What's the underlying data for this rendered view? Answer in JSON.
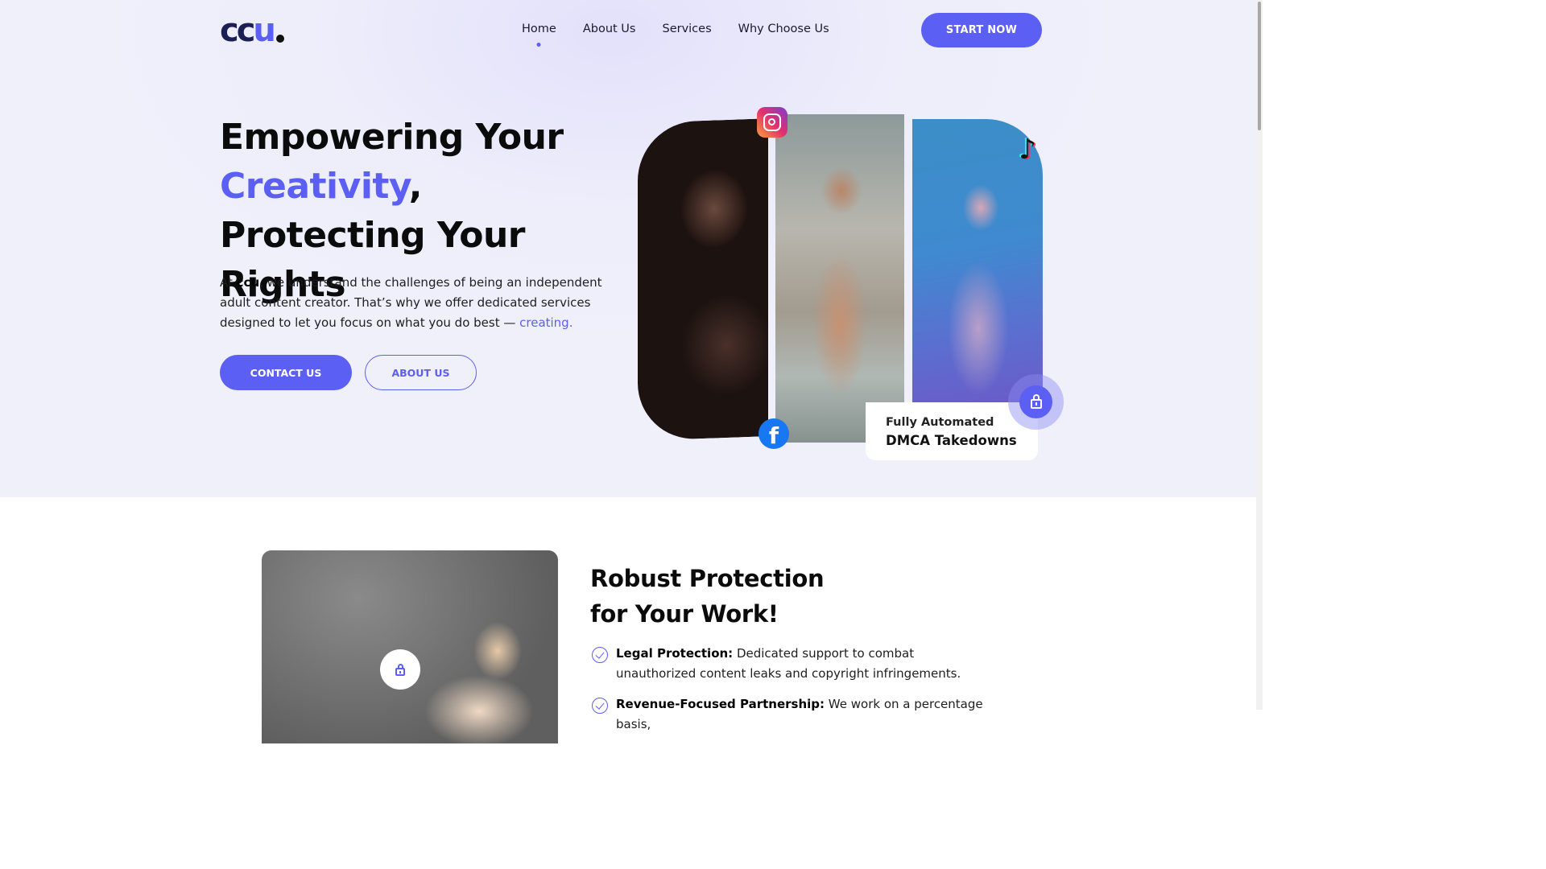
{
  "brand": {
    "logo_text_dark": "cc",
    "logo_text_accent": "u",
    "logo_alt": "ccu."
  },
  "nav": {
    "items": [
      {
        "label": "Home",
        "active": true
      },
      {
        "label": "About Us",
        "active": false
      },
      {
        "label": "Services",
        "active": false
      },
      {
        "label": "Why Choose Us",
        "active": false
      }
    ],
    "cta_label": "START NOW"
  },
  "hero": {
    "title_part1": "Empowering Your",
    "title_accent": "Creativity",
    "title_part2": ", Protecting Your Rights",
    "lead_prefix": "At ",
    "lead_brand": "ccu",
    "lead_body": ", we understand the challenges of being an independent adult content creator. That’s why we offer dedicated services designed to let you focus on what you do best — ",
    "lead_link": "creating.",
    "contact_label": "CONTACT US",
    "about_label": "ABOUT US",
    "badge_line1": "Fully Automated",
    "badge_line2": "DMCA Takedowns",
    "social_icons": [
      "instagram-icon",
      "tiktok-icon",
      "facebook-icon"
    ]
  },
  "protection": {
    "title_line1": "Robust Protection",
    "title_line2": "for Your Work!",
    "features": [
      {
        "title": "Legal Protection:",
        "text": " Dedicated support to combat unauthorized content leaks and copyright infringements."
      },
      {
        "title": "Revenue-Focused Partnership:",
        "text": " We work on a percentage basis,"
      }
    ]
  },
  "colors": {
    "accent": "#5b5ff3",
    "dark": "#0b0b0b",
    "hero_bg": "#f0f0fb"
  }
}
